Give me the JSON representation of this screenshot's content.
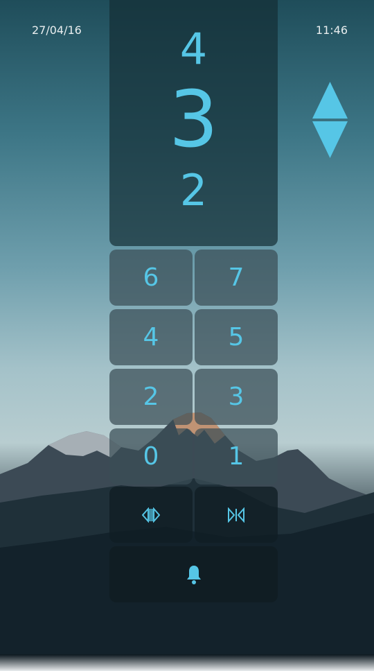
{
  "status": {
    "date": "27/04/16",
    "time": "11:46"
  },
  "floors": {
    "next": "4",
    "current": "3",
    "previous": "2"
  },
  "keypad": {
    "rows": [
      [
        "6",
        "7"
      ],
      [
        "4",
        "5"
      ],
      [
        "2",
        "3"
      ],
      [
        "0",
        "1"
      ]
    ]
  },
  "colors": {
    "accent": "#56c6e6"
  },
  "icons": {
    "direction": "up-down-arrows-icon",
    "open_doors": "doors-open-icon",
    "close_doors": "doors-close-icon",
    "alarm": "bell-icon"
  }
}
